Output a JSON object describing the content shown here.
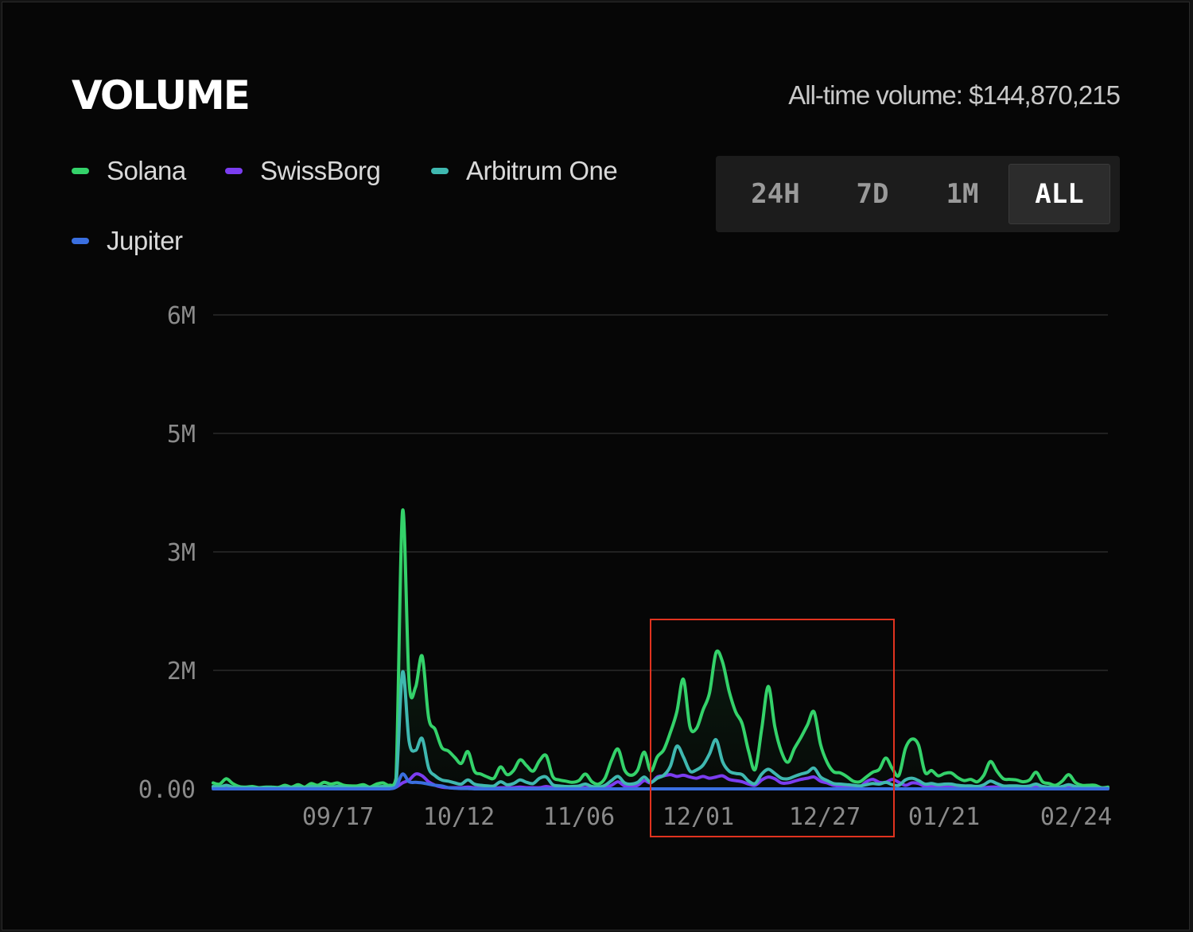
{
  "header": {
    "title": "VOLUME",
    "all_time_label": "All-time volume: $144,870,215"
  },
  "legend": [
    {
      "name": "Solana",
      "color": "#34d26a"
    },
    {
      "name": "SwissBorg",
      "color": "#7b3df0"
    },
    {
      "name": "Arbitrum One",
      "color": "#3fb8b0"
    },
    {
      "name": "Jupiter",
      "color": "#3a6fe0"
    }
  ],
  "range_selector": {
    "options": [
      "24H",
      "7D",
      "1M",
      "ALL"
    ],
    "selected": "ALL"
  },
  "annotation": {
    "type": "highlight-box",
    "color": "#e0331f",
    "covers": [
      "12/01",
      "12/27"
    ]
  },
  "chart_data": {
    "type": "line",
    "title": "",
    "xlabel": "",
    "ylabel": "",
    "ylim": [
      0,
      6000000
    ],
    "grid": true,
    "y_ticks": [
      {
        "value": 0,
        "label": "0.00"
      },
      {
        "value": 2000000,
        "label": "2M"
      },
      {
        "value": 3000000,
        "label": "3M"
      },
      {
        "value": 5000000,
        "label": "5M"
      },
      {
        "value": 6000000,
        "label": "6M"
      }
    ],
    "x_ticks": [
      "09/17",
      "10/12",
      "11/06",
      "12/01",
      "12/27",
      "01/21",
      "02/24"
    ],
    "series": [
      {
        "name": "Solana",
        "color": "#34d26a",
        "values": [
          100000,
          80000,
          170000,
          90000,
          40000,
          30000,
          40000,
          20000,
          30000,
          30000,
          25000,
          60000,
          30000,
          70000,
          30000,
          90000,
          60000,
          110000,
          80000,
          100000,
          60000,
          50000,
          50000,
          70000,
          30000,
          80000,
          100000,
          60000,
          180000,
          3690000,
          1800000,
          1720000,
          2120000,
          1200000,
          1000000,
          700000,
          640000,
          530000,
          430000,
          630000,
          300000,
          250000,
          200000,
          180000,
          370000,
          240000,
          310000,
          490000,
          390000,
          300000,
          480000,
          560000,
          210000,
          150000,
          130000,
          110000,
          140000,
          250000,
          120000,
          80000,
          180000,
          480000,
          670000,
          320000,
          230000,
          320000,
          620000,
          300000,
          540000,
          660000,
          950000,
          1300000,
          1850000,
          1050000,
          1020000,
          1330000,
          1620000,
          2150000,
          2070000,
          1650000,
          1300000,
          1100000,
          630000,
          330000,
          1020000,
          1730000,
          1050000,
          630000,
          450000,
          680000,
          870000,
          1080000,
          1300000,
          750000,
          450000,
          290000,
          270000,
          210000,
          130000,
          120000,
          200000,
          280000,
          330000,
          520000,
          340000,
          230000,
          680000,
          840000,
          740000,
          280000,
          310000,
          220000,
          260000,
          270000,
          190000,
          140000,
          160000,
          120000,
          230000,
          460000,
          300000,
          170000,
          160000,
          150000,
          120000,
          150000,
          280000,
          120000,
          90000,
          60000,
          130000,
          240000,
          110000,
          60000,
          60000,
          60000,
          20000,
          30000
        ],
        "fill": true
      },
      {
        "name": "SwissBorg",
        "color": "#7b3df0",
        "values": [
          20000,
          10000,
          10000,
          10000,
          10000,
          10000,
          10000,
          10000,
          10000,
          10000,
          10000,
          10000,
          10000,
          10000,
          10000,
          10000,
          10000,
          10000,
          10000,
          10000,
          10000,
          10000,
          10000,
          10000,
          10000,
          10000,
          10000,
          10000,
          30000,
          100000,
          150000,
          250000,
          220000,
          120000,
          60000,
          30000,
          20000,
          20000,
          20000,
          30000,
          20000,
          10000,
          10000,
          10000,
          20000,
          20000,
          20000,
          30000,
          20000,
          20000,
          20000,
          40000,
          20000,
          10000,
          10000,
          10000,
          10000,
          20000,
          10000,
          10000,
          20000,
          60000,
          120000,
          50000,
          40000,
          60000,
          140000,
          100000,
          200000,
          220000,
          240000,
          210000,
          230000,
          200000,
          180000,
          210000,
          180000,
          200000,
          220000,
          160000,
          140000,
          120000,
          80000,
          60000,
          150000,
          200000,
          170000,
          100000,
          100000,
          130000,
          160000,
          180000,
          200000,
          130000,
          100000,
          60000,
          50000,
          40000,
          30000,
          30000,
          120000,
          160000,
          110000,
          110000,
          160000,
          110000,
          60000,
          100000,
          90000,
          40000,
          40000,
          30000,
          30000,
          30000,
          20000,
          20000,
          20000,
          20000,
          20000,
          30000,
          30000,
          20000,
          20000,
          20000,
          20000,
          20000,
          30000,
          20000,
          10000,
          10000,
          10000,
          20000,
          20000,
          10000,
          10000,
          10000,
          10000,
          10000
        ]
      },
      {
        "name": "Arbitrum One",
        "color": "#3fb8b0",
        "values": [
          40000,
          30000,
          60000,
          30000,
          20000,
          20000,
          20000,
          15000,
          20000,
          20000,
          15000,
          30000,
          20000,
          30000,
          20000,
          40000,
          30000,
          40000,
          30000,
          40000,
          30000,
          20000,
          20000,
          30000,
          20000,
          30000,
          40000,
          30000,
          80000,
          1970000,
          800000,
          650000,
          850000,
          350000,
          220000,
          150000,
          130000,
          100000,
          80000,
          150000,
          80000,
          60000,
          50000,
          50000,
          120000,
          70000,
          90000,
          150000,
          110000,
          90000,
          180000,
          200000,
          70000,
          50000,
          40000,
          40000,
          50000,
          80000,
          40000,
          30000,
          60000,
          140000,
          210000,
          100000,
          80000,
          110000,
          200000,
          110000,
          180000,
          230000,
          380000,
          720000,
          540000,
          300000,
          320000,
          400000,
          590000,
          830000,
          460000,
          300000,
          260000,
          240000,
          130000,
          90000,
          250000,
          330000,
          260000,
          180000,
          170000,
          210000,
          250000,
          280000,
          350000,
          200000,
          140000,
          90000,
          80000,
          70000,
          60000,
          50000,
          70000,
          90000,
          80000,
          110000,
          70000,
          60000,
          150000,
          180000,
          140000,
          80000,
          90000,
          70000,
          80000,
          80000,
          60000,
          50000,
          50000,
          40000,
          70000,
          130000,
          90000,
          50000,
          50000,
          50000,
          40000,
          50000,
          80000,
          40000,
          30000,
          20000,
          40000,
          70000,
          40000,
          20000,
          20000,
          20000,
          10000,
          10000
        ]
      },
      {
        "name": "Jupiter",
        "color": "#3a6fe0",
        "values": [
          0,
          0,
          0,
          0,
          0,
          0,
          0,
          0,
          0,
          0,
          0,
          0,
          0,
          0,
          0,
          0,
          0,
          0,
          0,
          0,
          0,
          0,
          0,
          0,
          0,
          0,
          0,
          0,
          30000,
          250000,
          120000,
          110000,
          100000,
          80000,
          60000,
          50000,
          20000,
          10000,
          5000,
          5000,
          0,
          0,
          0,
          0,
          0,
          0,
          0,
          0,
          0,
          0,
          0,
          0,
          0,
          0,
          0,
          0,
          0,
          0,
          0,
          0,
          0,
          0,
          0,
          0,
          0,
          0,
          0,
          0,
          0,
          0,
          0,
          0,
          0,
          0,
          0,
          0,
          0,
          0,
          0,
          0,
          0,
          0,
          0,
          0,
          0,
          0,
          0,
          0,
          0,
          0,
          0,
          0,
          0,
          0,
          0,
          0,
          0,
          0,
          0,
          0,
          0,
          0,
          0,
          0,
          0,
          0,
          0,
          0,
          0,
          0,
          0,
          0,
          0,
          0,
          0,
          0,
          0,
          0,
          0,
          0,
          0,
          0,
          0,
          0,
          0,
          0,
          0,
          0,
          0,
          0,
          0,
          0,
          0,
          0,
          0,
          0,
          0,
          0
        ]
      }
    ]
  }
}
